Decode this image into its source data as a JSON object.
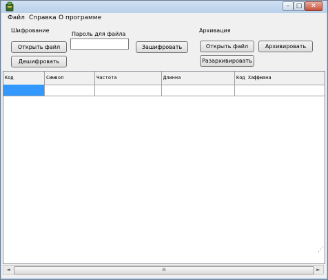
{
  "window": {
    "icon": "app-icon",
    "controls": {
      "minimize": "–",
      "maximize": "□",
      "close": "✕"
    }
  },
  "menu": {
    "items": [
      "Файл",
      "Справка",
      "О программе"
    ]
  },
  "encryption": {
    "title": "Шифрование",
    "password_label": "Пароль для файла",
    "password_value": "",
    "open_file": "Открыть файл",
    "encrypt": "Зашифровать",
    "decrypt": "Дешифровать"
  },
  "archive": {
    "title": "Архивация",
    "open_file": "Открыть файл",
    "archive": "Архивировать",
    "unarchive": "Разархивировать"
  },
  "table": {
    "columns": [
      "Код",
      "Символ",
      "Частота",
      "Длинна",
      "Код Хаффмана"
    ],
    "rows": [
      [
        "",
        "",
        "",
        "",
        ""
      ]
    ]
  },
  "scrollbar": {
    "left": "◄",
    "right": "►",
    "thumb": "III",
    "grip": "⋰"
  },
  "colors": {
    "selection": "#3399ff",
    "titlebar": "#b9d1ea",
    "client": "#f0f0f0"
  }
}
